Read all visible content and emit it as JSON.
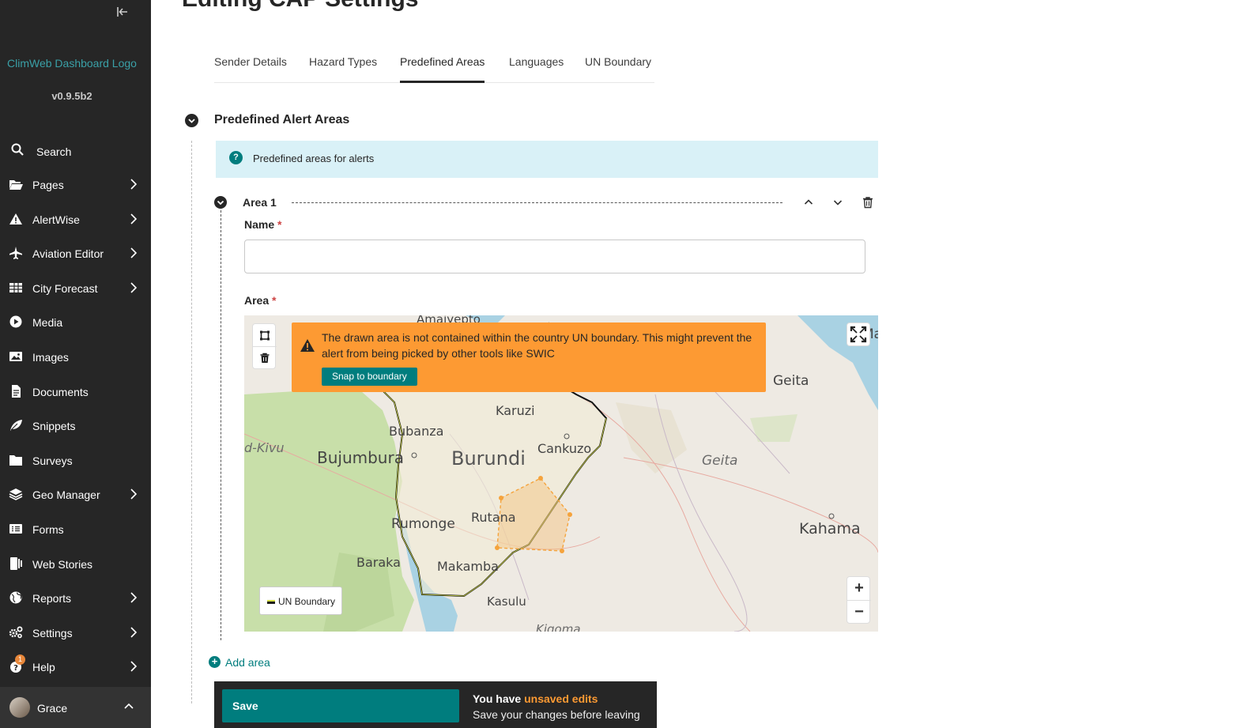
{
  "sidebar": {
    "logo_alt": "ClimWeb Dashboard Logo",
    "version": "v0.9.5b2",
    "search_label": "Search",
    "items": [
      {
        "label": "Pages",
        "icon": "folder-open-icon",
        "has_submenu": true
      },
      {
        "label": "AlertWise",
        "icon": "warning-icon",
        "has_submenu": true
      },
      {
        "label": "Aviation Editor",
        "icon": "plane-icon",
        "has_submenu": true
      },
      {
        "label": "City Forecast",
        "icon": "table-icon",
        "has_submenu": true
      },
      {
        "label": "Media",
        "icon": "play-icon",
        "has_submenu": false
      },
      {
        "label": "Images",
        "icon": "image-icon",
        "has_submenu": false
      },
      {
        "label": "Documents",
        "icon": "document-icon",
        "has_submenu": false
      },
      {
        "label": "Snippets",
        "icon": "snippet-icon",
        "has_submenu": false
      },
      {
        "label": "Surveys",
        "icon": "folder-icon",
        "has_submenu": false
      },
      {
        "label": "Geo Manager",
        "icon": "layers-icon",
        "has_submenu": true
      },
      {
        "label": "Forms",
        "icon": "list-icon",
        "has_submenu": false
      },
      {
        "label": "Web Stories",
        "icon": "stories-icon",
        "has_submenu": false
      },
      {
        "label": "Reports",
        "icon": "globe-icon",
        "has_submenu": true
      },
      {
        "label": "Settings",
        "icon": "cogs-icon",
        "has_submenu": true
      },
      {
        "label": "Help",
        "icon": "help-icon",
        "has_submenu": true,
        "badge": "1"
      }
    ],
    "account": {
      "name": "Grace"
    }
  },
  "header": {
    "title": "Editing CAP Settings"
  },
  "tabs": [
    {
      "label": "Sender Details",
      "active": false
    },
    {
      "label": "Hazard Types",
      "active": false
    },
    {
      "label": "Predefined Areas",
      "active": true
    },
    {
      "label": "Languages",
      "active": false
    },
    {
      "label": "UN Boundary",
      "active": false
    }
  ],
  "section": {
    "title": "Predefined Alert Areas",
    "help_text": "Predefined areas for alerts",
    "area": {
      "title": "Area 1",
      "name_label": "Name",
      "name_value": "",
      "area_label": "Area",
      "required_mark": "*"
    },
    "add_area_label": "Add area"
  },
  "map": {
    "warning_text": "The drawn area is not contained within the country UN boundary. This might prevent the alert from being picked by other tools like SWIC",
    "snap_label": "Snap to boundary",
    "legend_label": "UN Boundary",
    "zoom_in": "+",
    "zoom_out": "−",
    "place_labels": [
      "Amaiyepto",
      "Geita",
      "Karuzi",
      "Bubanza",
      "Cankuzo",
      "d-Kivu",
      "Bujumbura",
      "Burundi",
      "Geita",
      "Rutana",
      "Rumonge",
      "Kahama",
      "Baraka",
      "Makamba",
      "Kasulu",
      "Kigoma",
      "Ma"
    ],
    "colors": {
      "water": "#a9d2e3",
      "forest": "#c8dfa9",
      "land": "#eeeae3",
      "warning": "#fd9a33",
      "drawn": "#f5a33c"
    }
  },
  "footer": {
    "save_label": "Save",
    "unsaved_prefix": "You have ",
    "unsaved_highlight": "unsaved edits",
    "unsaved_sub": "Save your changes before leaving"
  },
  "colors": {
    "sidebar_bg": "#262626",
    "accent": "#007d7e",
    "help_bg": "#d9f1f7"
  }
}
